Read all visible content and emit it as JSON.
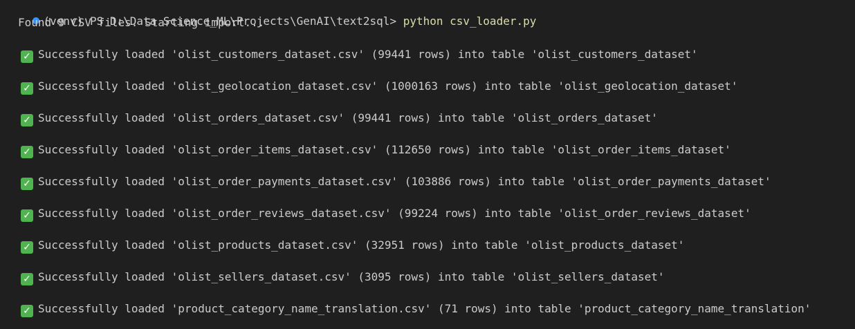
{
  "terminal": {
    "status_dot_color": "#3794ff",
    "prompt": "(venv) PS D:\\Data Science_ML\\Projects\\GenAI\\text2sql> ",
    "command": "python csv_loader.py",
    "found_message": "Found 9 CSV files. Starting import...",
    "check_icon": "white-heavy-check-mark-icon",
    "check_color": "#4fb34f",
    "lines": [
      "Successfully loaded 'olist_customers_dataset.csv' (99441 rows) into table 'olist_customers_dataset'",
      "Successfully loaded 'olist_geolocation_dataset.csv' (1000163 rows) into table 'olist_geolocation_dataset'",
      "Successfully loaded 'olist_orders_dataset.csv' (99441 rows) into table 'olist_orders_dataset'",
      "Successfully loaded 'olist_order_items_dataset.csv' (112650 rows) into table 'olist_order_items_dataset'",
      "Successfully loaded 'olist_order_payments_dataset.csv' (103886 rows) into table 'olist_order_payments_dataset'",
      "Successfully loaded 'olist_order_reviews_dataset.csv' (99224 rows) into table 'olist_order_reviews_dataset'",
      "Successfully loaded 'olist_products_dataset.csv' (32951 rows) into table 'olist_products_dataset'",
      "Successfully loaded 'olist_sellers_dataset.csv' (3095 rows) into table 'olist_sellers_dataset'",
      "Successfully loaded 'product_category_name_translation.csv' (71 rows) into table 'product_category_name_translation'"
    ]
  }
}
